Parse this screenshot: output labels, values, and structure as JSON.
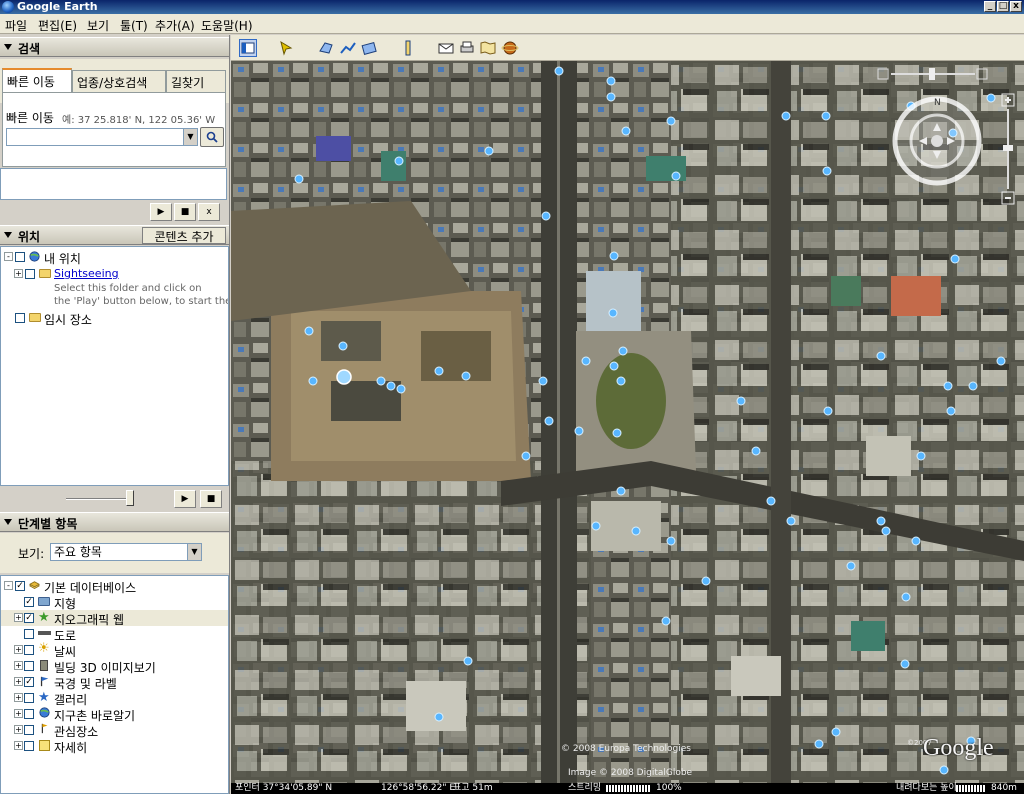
{
  "window": {
    "title": "Google Earth",
    "min": "_",
    "max": "□",
    "close": "x"
  },
  "menu": [
    "파일",
    "편집(E)",
    "보기",
    "툴(T)",
    "추가(A)",
    "도움말(H)"
  ],
  "search_panel": {
    "header": "검색",
    "tabs": [
      "빠른 이동",
      "업종/상호검색",
      "길찾기"
    ],
    "fly_to_label": "빠른 이동",
    "fly_to_hint": "예: 37 25.818' N, 122 05.36' W",
    "input_value": "",
    "search_icon": "magnifier-icon"
  },
  "places_panel": {
    "header": "위치",
    "add_content_button": "콘텐츠 추가",
    "items": [
      {
        "label": "내 위치",
        "icon": "globe-icon"
      },
      {
        "label": "Sightseeing",
        "icon": "folder-icon"
      },
      {
        "label": "Select this folder and click on"
      },
      {
        "label": "the 'Play' button below, to start the tour."
      },
      {
        "label": "임시 장소",
        "icon": "folder-icon"
      }
    ]
  },
  "layers_panel": {
    "header": "단계별 항목",
    "view_label": "보기:",
    "view_value": "주요 항목",
    "items": [
      {
        "label": "기본 데이터베이스",
        "checked": true,
        "icon": "stack-icon"
      },
      {
        "label": "지형",
        "checked": true,
        "icon": "terrain-icon"
      },
      {
        "label": "지오그래픽 웹",
        "checked": true,
        "icon": "star-icon"
      },
      {
        "label": "도로",
        "checked": false,
        "icon": "road-icon"
      },
      {
        "label": "날씨",
        "checked": false,
        "icon": "sun-icon"
      },
      {
        "label": "빌딩 3D 이미지보기",
        "checked": false,
        "icon": "building-icon"
      },
      {
        "label": "국경 및 라벨",
        "checked": true,
        "icon": "flag-icon"
      },
      {
        "label": "갤러리",
        "checked": false,
        "icon": "star-icon"
      },
      {
        "label": "지구촌 바로알기",
        "checked": false,
        "icon": "globe-icon"
      },
      {
        "label": "관심장소",
        "checked": false,
        "icon": "pin-icon"
      },
      {
        "label": "자세히",
        "checked": false,
        "icon": "note-icon"
      }
    ]
  },
  "map": {
    "copyright_1": "© 2008 Europa Technologies",
    "copyright_2": "Image © 2008 DigitalGlobe",
    "logo": "Google",
    "logo_year": "©2007"
  },
  "status": {
    "pointer": "포인터 37°34'05.89\" N",
    "lon": "126°58'56.22\" E",
    "elev": "표고  51m",
    "streaming_label": "스트리밍",
    "streaming_value": "100%",
    "eye_alt_label": "내려다보는 높이",
    "eye_alt_value": "840m"
  }
}
